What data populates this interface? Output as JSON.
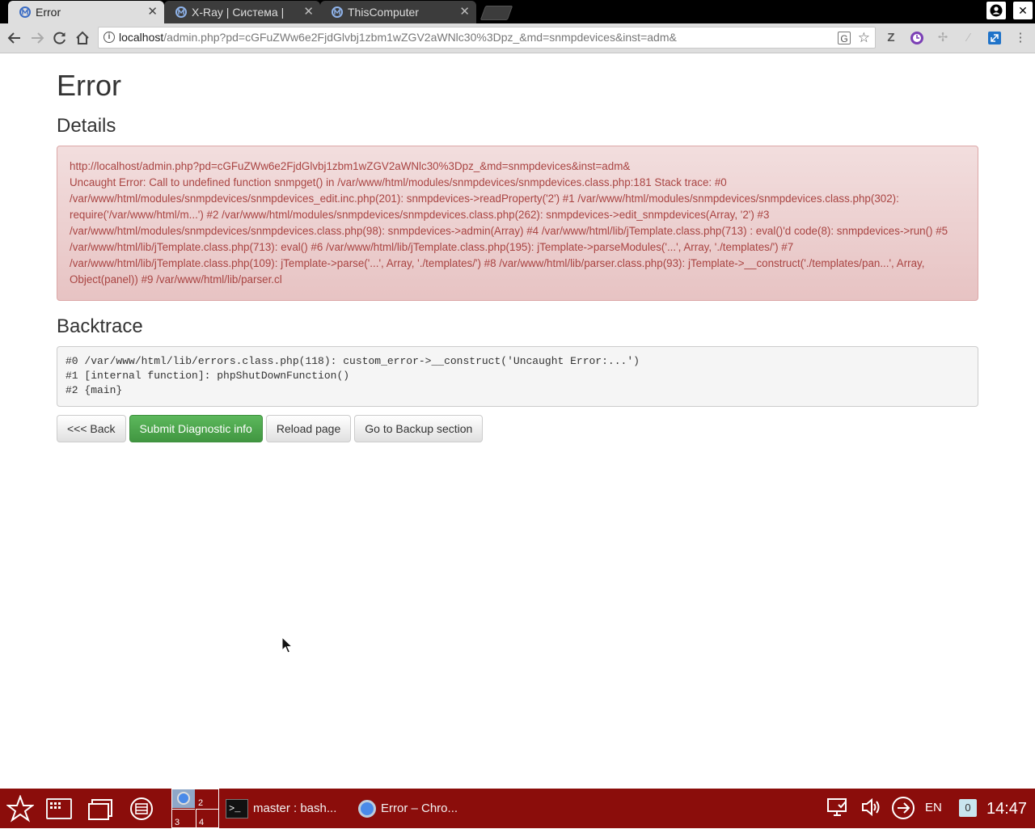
{
  "browser": {
    "tabs": [
      {
        "title": "Error",
        "active": true
      },
      {
        "title": "X-Ray | Система | Панель",
        "active": false
      },
      {
        "title": "ThisComputer",
        "active": false
      }
    ],
    "close_glyph": "✕",
    "url_host": "localhost",
    "url_rest": "/admin.php?pd=cGFuZWw6e2FjdGlvbj1zbm1wZGV2aWNlc30%3Dpz_&md=snmpdevices&inst=adm&",
    "icons": [
      "back-icon",
      "forward-icon",
      "reload-icon",
      "home-icon",
      "info-icon",
      "translate-icon",
      "star-icon",
      "extension-z-icon",
      "extension-clock-icon",
      "extension-move-icon",
      "extension-disabled-icon",
      "extension-resize-icon",
      "menu-icon"
    ]
  },
  "page": {
    "title": "Error",
    "details_heading": "Details",
    "details_url": "http://localhost/admin.php?pd=cGFuZWw6e2FjdGlvbj1zbm1wZGV2aWNlc30%3Dpz_&md=snmpdevices&inst=adm&",
    "details_message": "Uncaught Error: Call to undefined function snmpget() in /var/www/html/modules/snmpdevices/snmpdevices.class.php:181 Stack trace: #0 /var/www/html/modules/snmpdevices/snmpdevices_edit.inc.php(201): snmpdevices->readProperty('2') #1 /var/www/html/modules/snmpdevices/snmpdevices.class.php(302): require('/var/www/html/m...') #2 /var/www/html/modules/snmpdevices/snmpdevices.class.php(262): snmpdevices->edit_snmpdevices(Array, '2') #3 /var/www/html/modules/snmpdevices/snmpdevices.class.php(98): snmpdevices->admin(Array) #4 /var/www/html/lib/jTemplate.class.php(713) : eval()'d code(8): snmpdevices->run() #5 /var/www/html/lib/jTemplate.class.php(713): eval() #6 /var/www/html/lib/jTemplate.class.php(195): jTemplate->parseModules('...', Array, './templates/') #7 /var/www/html/lib/jTemplate.class.php(109): jTemplate->parse('...', Array, './templates/') #8 /var/www/html/lib/parser.class.php(93): jTemplate->__construct('./templates/pan...', Array, Object(panel)) #9 /var/www/html/lib/parser.cl",
    "backtrace_heading": "Backtrace",
    "backtrace_lines": [
      "#0 /var/www/html/lib/errors.class.php(118): custom_error->__construct('Uncaught Error:...')",
      "#1 [internal function]: phpShutDownFunction()",
      "#2 {main}"
    ],
    "buttons": {
      "back": "<<< Back",
      "submit": "Submit Diagnostic info",
      "reload": "Reload page",
      "backup": "Go to Backup section"
    }
  },
  "taskbar": {
    "pager": [
      "2",
      "3",
      "4"
    ],
    "tasks": [
      {
        "label": "master : bash...",
        "icon": "terminal-icon"
      },
      {
        "label": "Error – Chro...",
        "icon": "chrome-icon"
      }
    ],
    "terminal_prompt": ">_",
    "language": "EN",
    "notifications": "0",
    "clock": "14:47"
  },
  "colors": {
    "taskbar": "#8b0d0b",
    "alert_bg": "#f2dede",
    "alert_text": "#a94442",
    "success": "#5cb85c"
  }
}
